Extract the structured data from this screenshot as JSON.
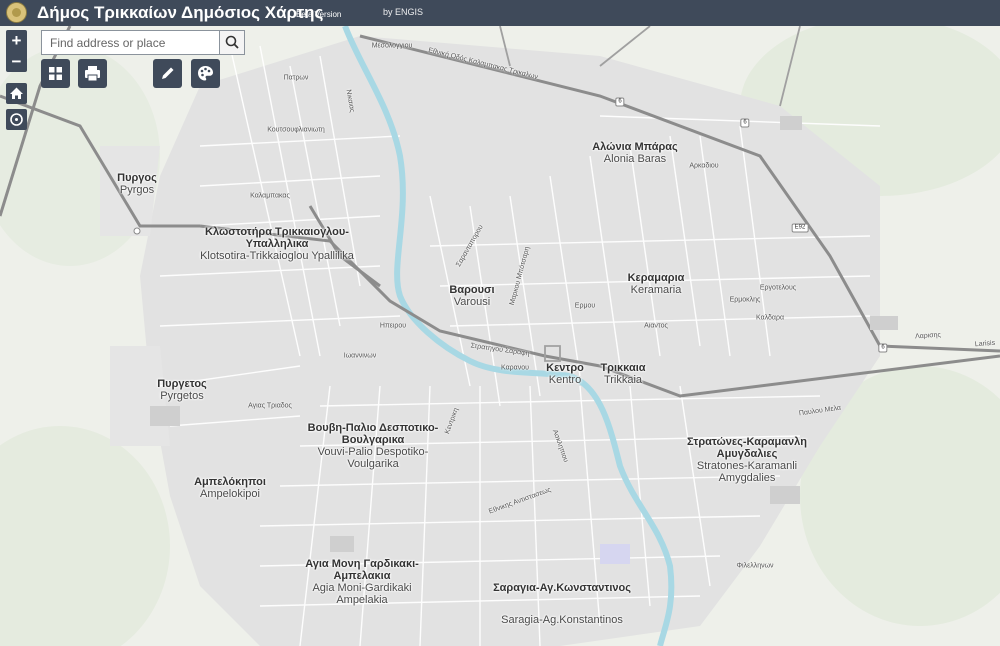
{
  "header": {
    "title": "Δήμος Τρικκαίων Δημόσιος Χάρτης",
    "badge": "Beta Version",
    "credit": "by ENGIS"
  },
  "search": {
    "placeholder": "Find address or place"
  },
  "controls": {
    "zoom_in": "+",
    "zoom_out": "−"
  },
  "icons": {
    "logo": "municipality-logo",
    "search": "search-icon",
    "basemap": "basemap-gallery-icon",
    "print": "print-icon",
    "measure": "pencil-icon",
    "layers": "palette-icon",
    "home": "home-icon",
    "locate": "locate-icon"
  },
  "colors": {
    "header": "#3f4a5a",
    "river": "#a8d8e4",
    "main_road": "#8c8c8c",
    "park": "#d8e8c8"
  },
  "areas": [
    {
      "id": "alonia-baras",
      "greek": "Αλώνια Μπάρας",
      "latin": "Alonia Baras"
    },
    {
      "id": "pyrgos",
      "greek": "Πυργος",
      "latin": "Pyrgos"
    },
    {
      "id": "klostotira",
      "greek": "Κλωστοτήρα Τρικκαιογλου-Υπαλληλικα",
      "latin": "Klotsotira-Trikkaioglou Ypallilika"
    },
    {
      "id": "varousi",
      "greek": "Βαρουσι",
      "latin": "Varousi"
    },
    {
      "id": "keramaria",
      "greek": "Κεραμαρια",
      "latin": "Keramaria"
    },
    {
      "id": "pyrgetos",
      "greek": "Πυργετος",
      "latin": "Pyrgetos"
    },
    {
      "id": "kentro",
      "greek": "Κεντρο",
      "latin": "Kentro"
    },
    {
      "id": "trikkaia",
      "greek": "Τρικκαια",
      "latin": "Trikkaia"
    },
    {
      "id": "vouvi",
      "greek": "Βουβη-Παλιο Δεσποτικο-Βουλγαρικα",
      "latin": "Vouvi-Palio Despotiko-Voulgarika"
    },
    {
      "id": "stratones",
      "greek": "Στρατώνες-Καραμανλη Αμυγδαλιες",
      "latin": "Stratones-Karamanli Amygdalies"
    },
    {
      "id": "ampelokipoi",
      "greek": "Αμπελόκηποι",
      "latin": "Ampelokipoi"
    },
    {
      "id": "agia-moni",
      "greek": "Αγια Μονη Γαρδικακι-Αμπελακια",
      "latin": "Agia Moni-Gardikaki Ampelakia"
    },
    {
      "id": "saragia",
      "greek": "Σαραγια-Αγ.Κωνσταντινος",
      "latin": "Saragia-Ag.Konstantinos"
    }
  ],
  "streets": [
    "Εθνική Οδός Καλαμπακας Τρικαλων",
    "Στρατηγού Σαραφη",
    "Λαρισης",
    "Larisis",
    "Καρανου",
    "Ασκληπιου",
    "Εθνικης Αντιστασεως",
    "Παυλου Μελα",
    "Καλδαρα",
    "Ερμοκλης",
    "Εργοτελους",
    "Μεσολογγιου",
    "Πατρων",
    "Σαρανταπορου",
    "Μαρκου Μπότσαρη",
    "Ηπειρου",
    "Κουτσουφλιανιωτη",
    "Ιωαννινων",
    "Ερμου",
    "Καλαμπακας",
    "Αιαντος",
    "Κεντρικη",
    "Φιλελληνων",
    "Αρκαδιου",
    "Αγιας Τριαδος",
    "Νικαιας"
  ],
  "shields": [
    "6",
    "6",
    "E92",
    "6"
  ]
}
